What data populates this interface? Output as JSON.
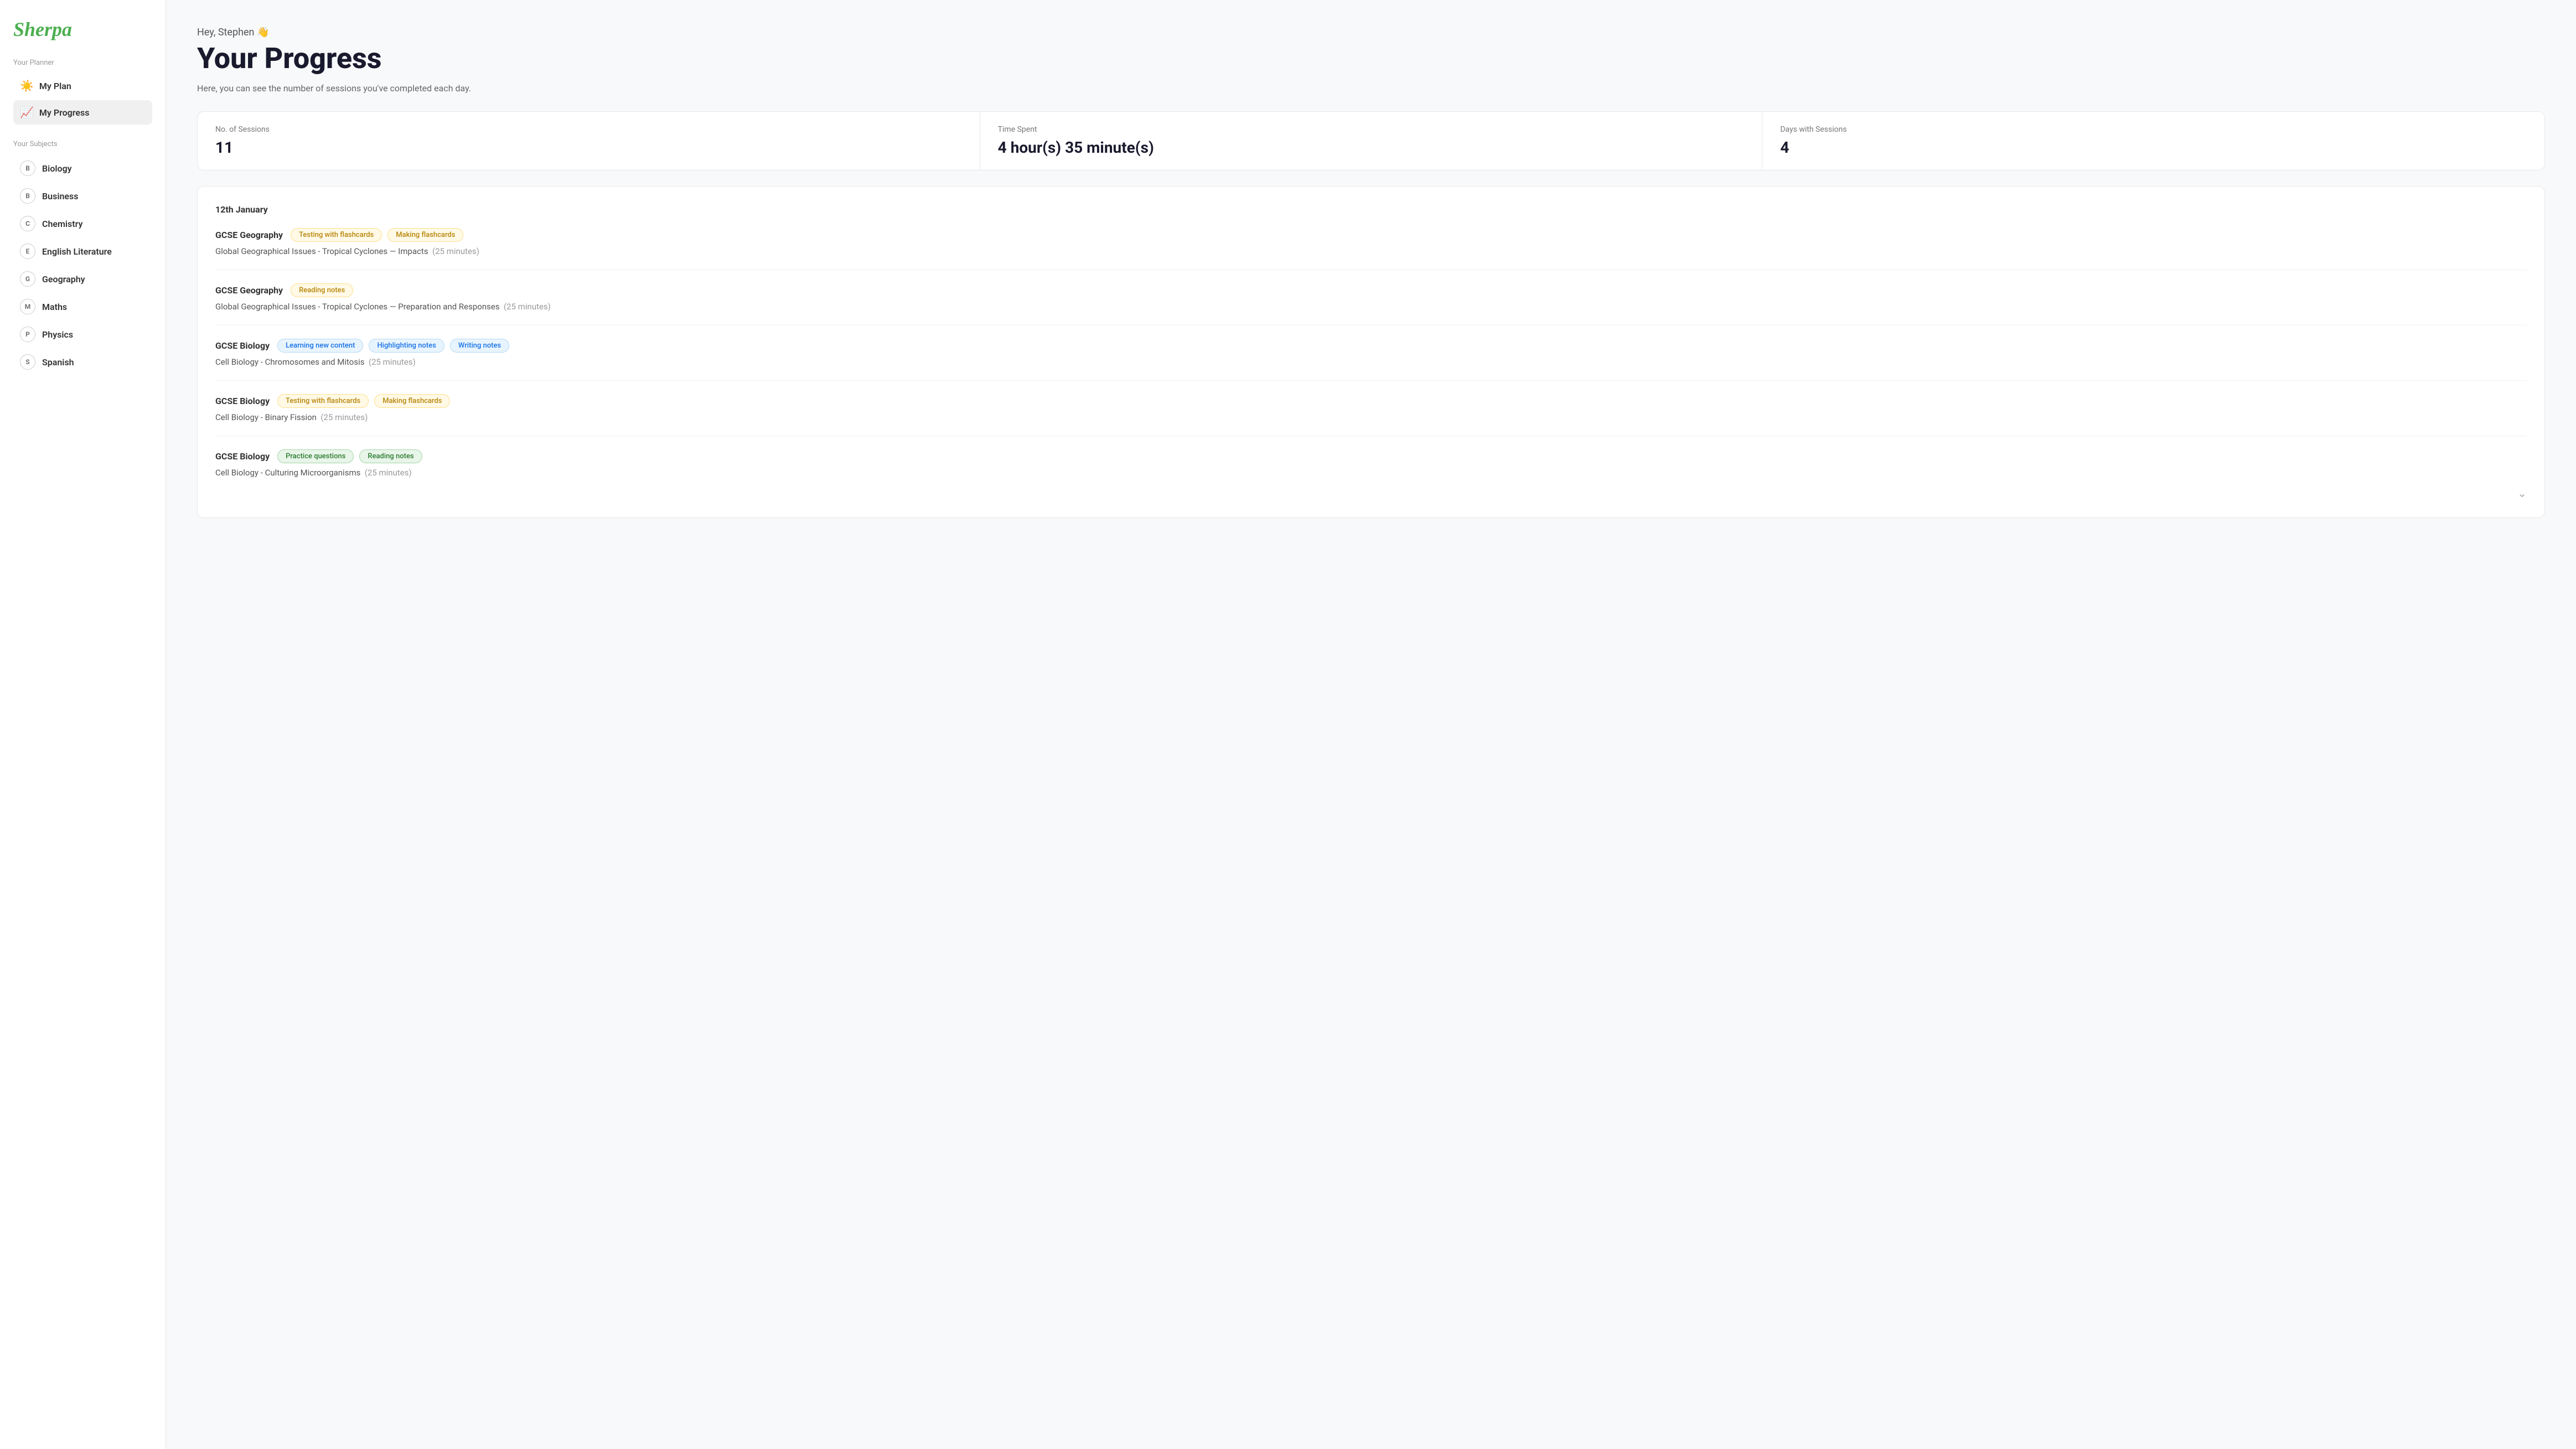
{
  "sidebar": {
    "logo": "Sherpa",
    "planner_label": "Your Planner",
    "nav_items": [
      {
        "id": "my-plan",
        "label": "My Plan",
        "icon": "☀️",
        "active": false
      },
      {
        "id": "my-progress",
        "label": "My Progress",
        "icon": "📈",
        "active": true
      }
    ],
    "subjects_label": "Your Subjects",
    "subjects": [
      {
        "id": "biology",
        "label": "Biology",
        "badge": "B"
      },
      {
        "id": "business",
        "label": "Business",
        "badge": "B"
      },
      {
        "id": "chemistry",
        "label": "Chemistry",
        "badge": "C"
      },
      {
        "id": "english-literature",
        "label": "English Literature",
        "badge": "E"
      },
      {
        "id": "geography",
        "label": "Geography",
        "badge": "G"
      },
      {
        "id": "maths",
        "label": "Maths",
        "badge": "M"
      },
      {
        "id": "physics",
        "label": "Physics",
        "badge": "P"
      },
      {
        "id": "spanish",
        "label": "Spanish",
        "badge": "S"
      }
    ]
  },
  "header": {
    "greeting": "Hey, Stephen 👋",
    "title": "Your Progress",
    "subtitle": "Here, you can see the number of sessions you've completed each day."
  },
  "stats": {
    "sessions_label": "No. of Sessions",
    "sessions_value": "11",
    "time_label": "Time Spent",
    "time_value": "4 hour(s) 35 minute(s)",
    "days_label": "Days with Sessions",
    "days_value": "4"
  },
  "sessions_card": {
    "date": "12th January",
    "sessions": [
      {
        "subject": "GCSE Geography",
        "tags": [
          {
            "label": "Testing with flashcards",
            "type": "yellow"
          },
          {
            "label": "Making flashcards",
            "type": "yellow"
          }
        ],
        "description": "Global Geographical Issues - Tropical Cyclones — Impacts",
        "time": "(25 minutes)"
      },
      {
        "subject": "GCSE Geography",
        "tags": [
          {
            "label": "Reading notes",
            "type": "yellow"
          }
        ],
        "description": "Global Geographical Issues - Tropical Cyclones — Preparation and Responses",
        "time": "(25 minutes)"
      },
      {
        "subject": "GCSE Biology",
        "tags": [
          {
            "label": "Learning new content",
            "type": "blue"
          },
          {
            "label": "Highlighting notes",
            "type": "blue"
          },
          {
            "label": "Writing notes",
            "type": "blue"
          }
        ],
        "description": "Cell Biology - Chromosomes and Mitosis",
        "time": "(25 minutes)"
      },
      {
        "subject": "GCSE Biology",
        "tags": [
          {
            "label": "Testing with flashcards",
            "type": "yellow"
          },
          {
            "label": "Making flashcards",
            "type": "yellow"
          }
        ],
        "description": "Cell Biology - Binary Fission",
        "time": "(25 minutes)"
      },
      {
        "subject": "GCSE Biology",
        "tags": [
          {
            "label": "Practice questions",
            "type": "green"
          },
          {
            "label": "Reading notes",
            "type": "green"
          }
        ],
        "description": "Cell Biology - Culturing Microorganisms",
        "time": "(25 minutes)"
      }
    ]
  }
}
